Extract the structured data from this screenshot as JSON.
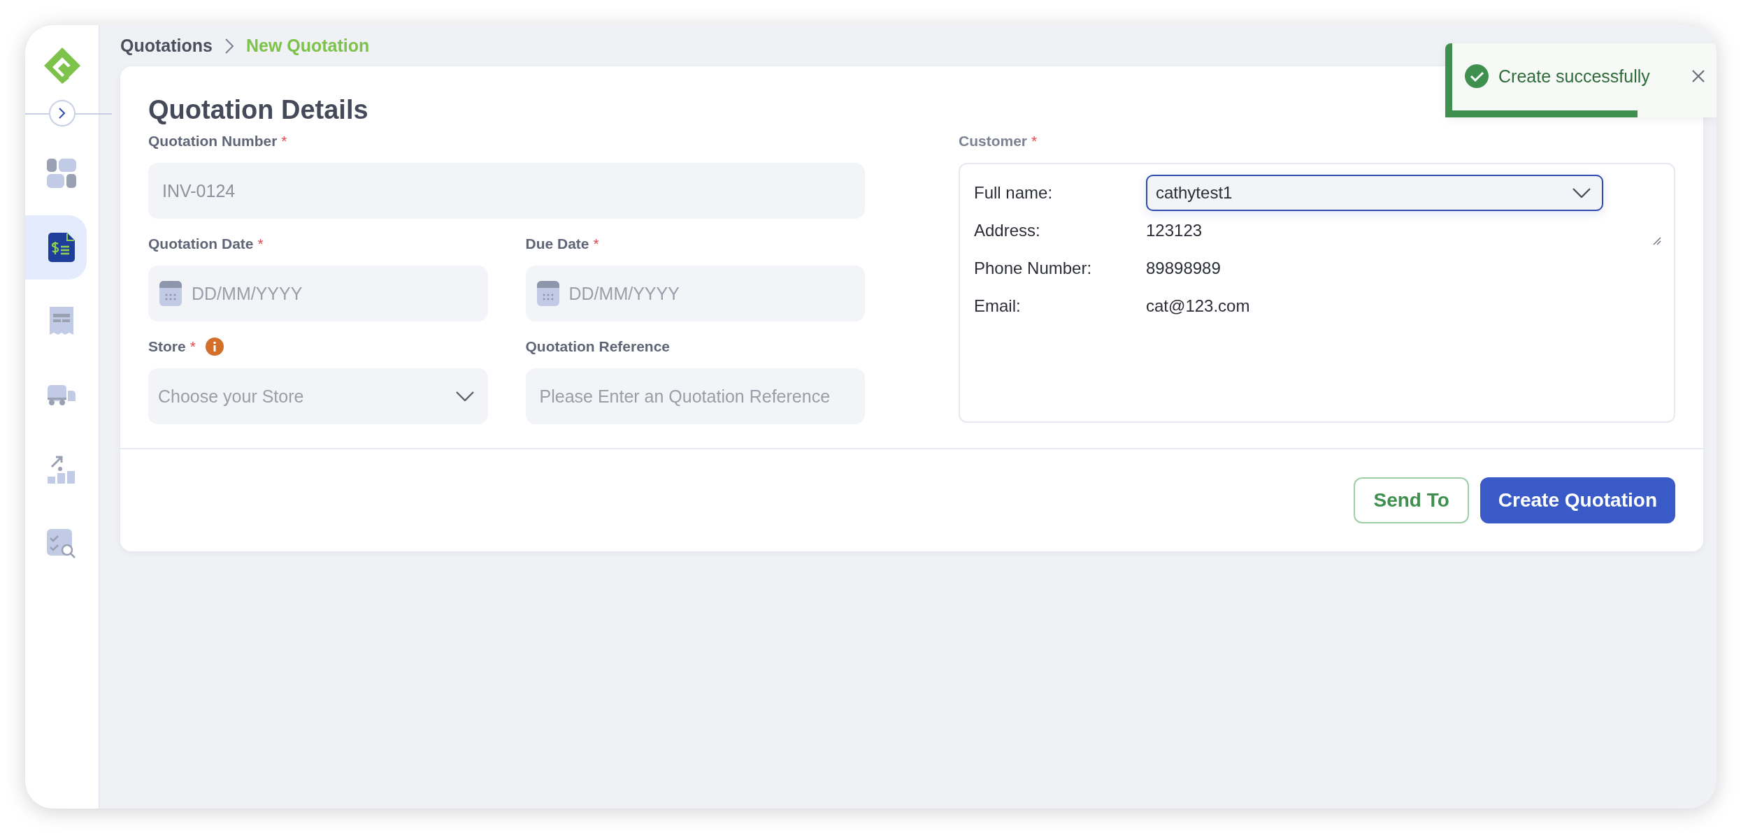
{
  "sidebar": {
    "items": [
      {
        "kind": "dashboard",
        "selected": false
      },
      {
        "kind": "quotation",
        "selected": true
      },
      {
        "kind": "receipt",
        "selected": false
      },
      {
        "kind": "truck",
        "selected": false
      },
      {
        "kind": "growth",
        "selected": false
      },
      {
        "kind": "checklist",
        "selected": false
      }
    ]
  },
  "breadcrumb": [
    {
      "label": "Quotations",
      "selected": false
    },
    {
      "label": "New Quotation",
      "selected": true
    }
  ],
  "form": {
    "title": "Quotation Details",
    "rows": [
      [
        {
          "label": "Quotation Number",
          "required_mark": "*",
          "kind": "text",
          "value": "INV-0124",
          "disabled": true
        }
      ],
      [
        {
          "label": "Quotation Date",
          "required_mark": "*",
          "kind": "date",
          "placeholder": "DD/MM/YYYY"
        },
        {
          "label": "Due Date",
          "required_mark": "*",
          "kind": "date",
          "placeholder": "DD/MM/YYYY"
        }
      ],
      [
        {
          "label": "Store",
          "required_mark": "*",
          "info": true,
          "kind": "select",
          "placeholder": "Choose your Store"
        },
        {
          "label": "Quotation Reference",
          "kind": "text",
          "placeholder": "Please Enter an Quotation Reference"
        }
      ]
    ]
  },
  "customer": {
    "label": "Customer",
    "required_mark": "*",
    "fields": [
      {
        "label": "Full name:",
        "kind": "select",
        "value": "cathytest1",
        "focused": true
      },
      {
        "label": "Address:",
        "kind": "text",
        "value": "123123"
      },
      {
        "label": "Phone Number:",
        "kind": "text",
        "value": "89898989"
      },
      {
        "label": "Email:",
        "kind": "text",
        "value": "cat@123.com"
      }
    ]
  },
  "buttons": [
    {
      "label": "Send To",
      "kind": "outline"
    },
    {
      "label": "Create Quotation",
      "kind": "primary"
    }
  ],
  "toast": {
    "kind": "success",
    "message": "Create successfully",
    "level": 0.71
  }
}
